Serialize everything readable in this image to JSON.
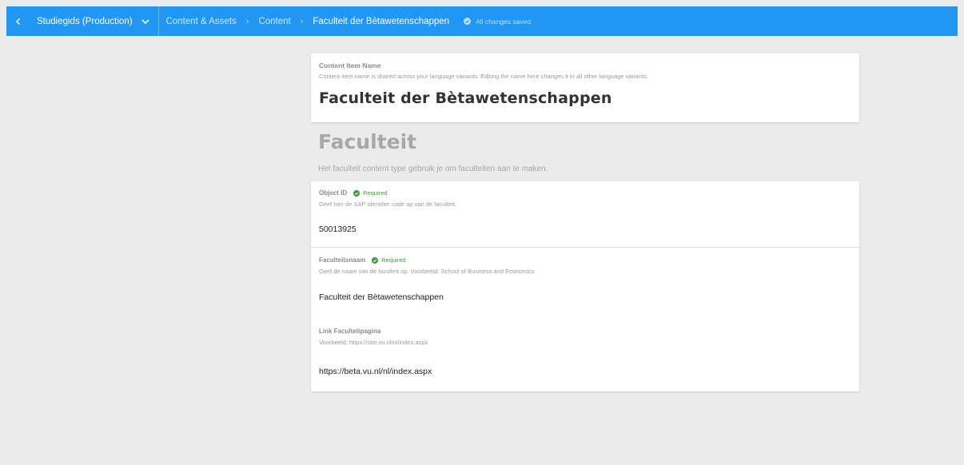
{
  "topbar": {
    "project_name": "Studiegids (Production)",
    "breadcrumbs": [
      "Content & Assets",
      "Content"
    ],
    "current": "Faculteit der Bètawetenschappen",
    "saved_status": "All changes saved",
    "accent_color": "#2196f3",
    "icons": {
      "back": "chevron-left-icon",
      "project_menu": "chevron-down-icon",
      "saved": "check-circle-icon"
    }
  },
  "name_card": {
    "label": "Content Item Name",
    "hint": "Content item name is shared across your language variants. Editing the name here changes it in all other language variants.",
    "value": "Faculteit der Bètawetenschappen"
  },
  "content_type": {
    "title": "Faculteit",
    "description": "Het faculteit content type gebruik je om faculteiten aan te maken."
  },
  "elements": [
    {
      "label": "Object ID",
      "required": "Required",
      "hint": "Geef hier de SAP identifier code op van de faculteit.",
      "value": "50013925"
    },
    {
      "label": "Faculteitsnaam",
      "required": "Required",
      "hint": "Geef de naam van de faculteit op. Voorbeeld: School of Business and Economics",
      "value": "Faculteit der Bètawetenschappen"
    },
    {
      "label": "Link Faculteitpagina",
      "hint": "Voorbeeld: https://sbe.vu.nl/nl/index.aspx",
      "value": "https://beta.vu.nl/nl/index.aspx"
    }
  ],
  "required_color": "#3d9a3d"
}
